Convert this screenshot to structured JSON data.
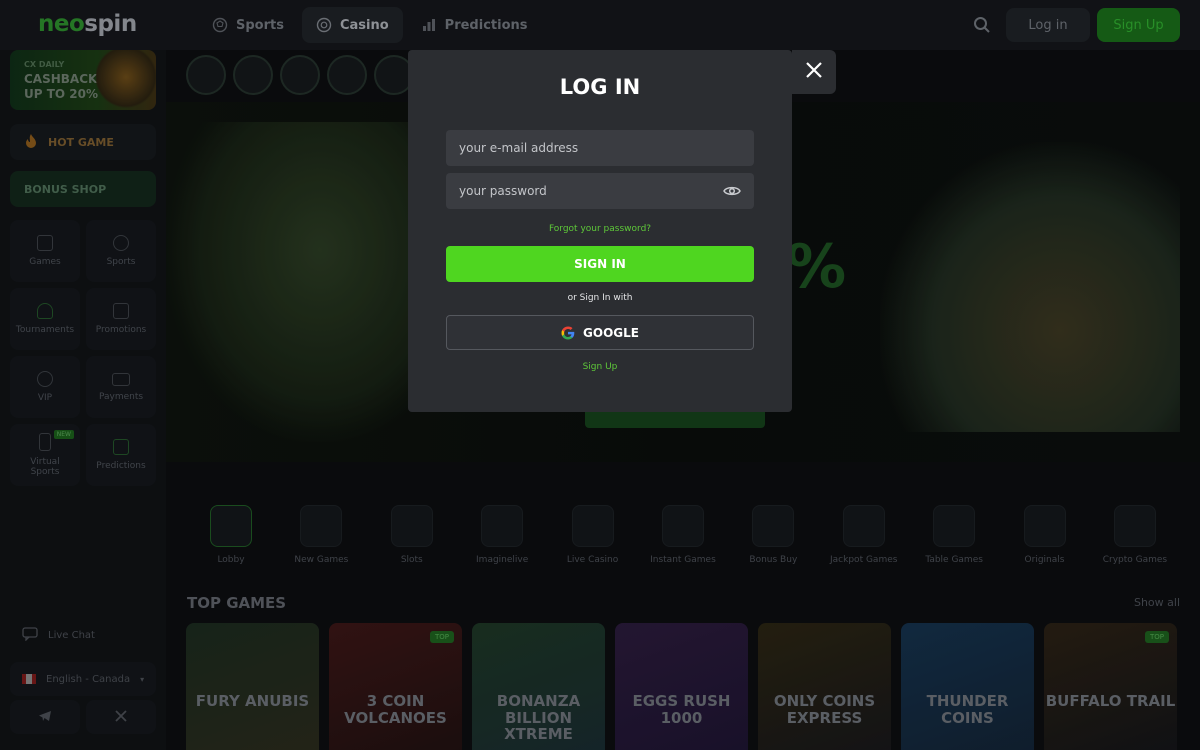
{
  "header": {
    "logo": {
      "part1": "neo",
      "part2": "spin"
    },
    "tabs": [
      {
        "label": "Sports",
        "icon": "ball-icon"
      },
      {
        "label": "Casino",
        "icon": "chip-icon"
      },
      {
        "label": "Predictions",
        "icon": "bar-chart-icon"
      }
    ],
    "login_label": "Log in",
    "signup_label": "Sign Up"
  },
  "sidebar": {
    "promo": {
      "line1": "CX DAILY",
      "line2": "CASHBACK",
      "line3": "UP TO 20%"
    },
    "hot_game": "HOT GAME",
    "bonus_shop": "BONUS SHOP",
    "items": [
      {
        "label": "Games"
      },
      {
        "label": "Sports"
      },
      {
        "label": "Tournaments"
      },
      {
        "label": "Promotions"
      },
      {
        "label": "VIP"
      },
      {
        "label": "Payments"
      },
      {
        "label": "Virtual Sports",
        "badge": "NEW"
      },
      {
        "label": "Predictions"
      }
    ],
    "live_chat": "Live Chat",
    "language": "English - Canada"
  },
  "hero": {
    "percent": "%"
  },
  "categories": [
    {
      "label": "Lobby"
    },
    {
      "label": "New Games"
    },
    {
      "label": "Slots"
    },
    {
      "label": "Imaginelive"
    },
    {
      "label": "Live Casino"
    },
    {
      "label": "Instant Games"
    },
    {
      "label": "Bonus Buy"
    },
    {
      "label": "Jackpot Games"
    },
    {
      "label": "Table Games"
    },
    {
      "label": "Originals"
    },
    {
      "label": "Crypto Games"
    }
  ],
  "top_games": {
    "title": "TOP GAMES",
    "show_all": "Show all",
    "games": [
      {
        "title": "FURY ANUBIS",
        "badge": "",
        "color1": "#1b2a1e",
        "color2": "#2a2a1c"
      },
      {
        "title": "3 COIN VOLCANOES",
        "badge": "TOP",
        "color1": "#3a1616",
        "color2": "#1e1010"
      },
      {
        "title": "BONANZA BILLION XTREME",
        "badge": "",
        "color1": "#1d3524",
        "color2": "#182a30"
      },
      {
        "title": "EGGS RUSH 1000",
        "badge": "",
        "color1": "#2a1a3a",
        "color2": "#1c1430"
      },
      {
        "title": "ONLY COINS EXPRESS",
        "badge": "",
        "color1": "#2a2412",
        "color2": "#16161a"
      },
      {
        "title": "THUNDER COINS",
        "badge": "",
        "color1": "#14304a",
        "color2": "#122233"
      },
      {
        "title": "BUFFALO TRAIL",
        "badge": "TOP",
        "color1": "#2a2014",
        "color2": "#121418"
      }
    ]
  },
  "modal": {
    "title": "LOG IN",
    "email_placeholder": "your e-mail address",
    "password_placeholder": "your password",
    "forgot": "Forgot your password?",
    "signin": "SIGN IN",
    "or_with": "or Sign In with",
    "google": "GOOGLE",
    "signup": "Sign Up"
  },
  "colors": {
    "accent": "#4fd620",
    "link": "#5ec839",
    "modal_bg": "#2b2d31"
  }
}
